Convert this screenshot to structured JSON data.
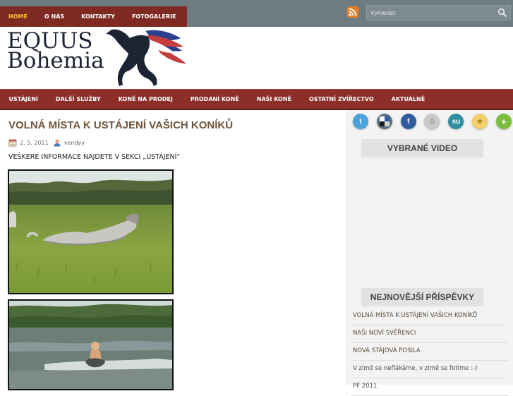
{
  "top_nav": {
    "items": [
      {
        "label": "HOME"
      },
      {
        "label": "O NÁS"
      },
      {
        "label": "KONTAKTY"
      },
      {
        "label": "FOTOGALERIE"
      }
    ]
  },
  "search": {
    "placeholder": "Vyhledat"
  },
  "logo": {
    "line1": "EQUUS",
    "line2": "Bohemia"
  },
  "main_nav": {
    "items": [
      {
        "label": "USTÁJENÍ"
      },
      {
        "label": "DALŠÍ SLUŽBY"
      },
      {
        "label": "KONĚ NA PRODEJ"
      },
      {
        "label": "PRODANÍ KONĚ"
      },
      {
        "label": "NAŠI KONĚ"
      },
      {
        "label": "OSTATNÍ ZVÍŘECTVO"
      },
      {
        "label": "AKTUÁLNĚ"
      }
    ]
  },
  "post": {
    "title": "VOLNÁ MÍSTA K USTÁJENÍ VAŠICH KONÍKŮ",
    "date": "2. 5. 2011",
    "author": "vendyy",
    "text": "VEŠKERÉ INFORMACE NAJDETE V SEKCI „USTÁJENÍ“"
  },
  "social": [
    {
      "icon": "twitter-icon",
      "glyph": "t",
      "color": "#4aa3d9"
    },
    {
      "icon": "delicious-icon",
      "glyph": "",
      "color": "#5b6f80"
    },
    {
      "icon": "facebook-icon",
      "glyph": "f",
      "color": "#2f5c9e"
    },
    {
      "icon": "myspace-icon",
      "glyph": "☺",
      "color": "#c9c9c9"
    },
    {
      "icon": "stumbleupon-icon",
      "glyph": "su",
      "color": "#2f8fa0"
    },
    {
      "icon": "favorites-icon",
      "glyph": "★",
      "color": "#f1d06b"
    },
    {
      "icon": "add-icon",
      "glyph": "+",
      "color": "#7cbd3c"
    }
  ],
  "sidebar": {
    "video_title": "VYBRANÉ VIDEO",
    "latest_title": "NEJNOVĚJŠÍ PŘÍSPĚVKY",
    "latest_items": [
      {
        "label": "VOLNÁ MÍSTA K USTÁJENÍ VAŠICH KONÍKŮ"
      },
      {
        "label": "NAŠI NOVÍ SVĚŘENCI"
      },
      {
        "label": "NOVÁ STÁJOVÁ POSILA"
      },
      {
        "label": "V zimě se neflákáme, v zimě se fotíme :-)"
      },
      {
        "label": "PF 2011"
      }
    ]
  },
  "colors": {
    "nav_red": "#8b2f28",
    "top_bar": "#6e7c82",
    "active_nav": "#f7c230",
    "title_brown": "#70553c"
  }
}
